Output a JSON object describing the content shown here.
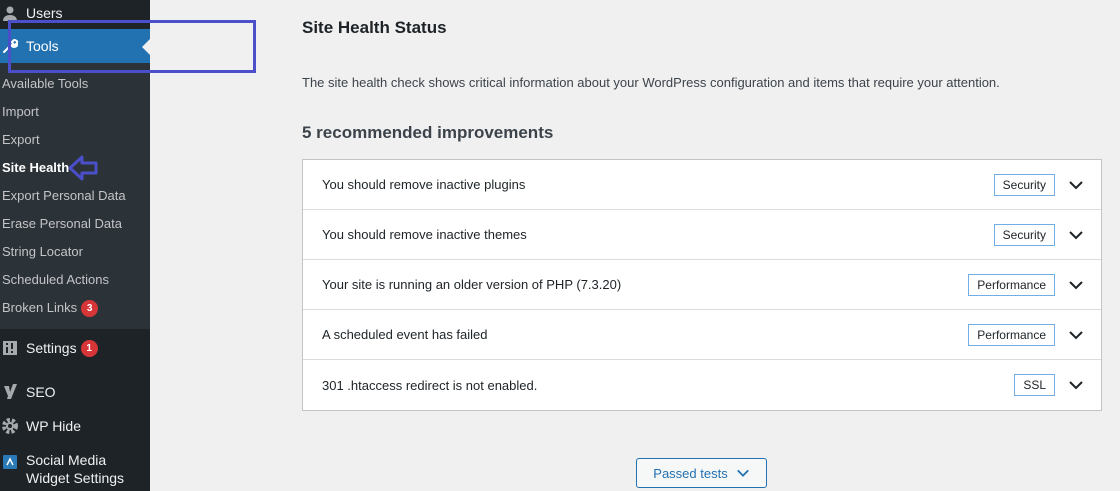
{
  "sidebar": {
    "users": "Users",
    "tools": "Tools",
    "submenu": [
      {
        "label": "Available Tools"
      },
      {
        "label": "Import"
      },
      {
        "label": "Export"
      },
      {
        "label": "Site Health"
      },
      {
        "label": "Export Personal Data"
      },
      {
        "label": "Erase Personal Data"
      },
      {
        "label": "String Locator"
      },
      {
        "label": "Scheduled Actions"
      },
      {
        "label": "Broken Links",
        "badge": "3"
      }
    ],
    "settings": {
      "label": "Settings",
      "badge": "1"
    },
    "seo": "SEO",
    "wphide": "WP Hide",
    "social": {
      "line1": "Social Media",
      "line2": "Widget Settings"
    }
  },
  "main": {
    "title": "Site Health Status",
    "description": "The site health check shows critical information about your WordPress configuration and items that require your attention.",
    "recommended_heading": "5 recommended improvements",
    "issues": [
      {
        "title": "You should remove inactive plugins",
        "badge": "Security"
      },
      {
        "title": "You should remove inactive themes",
        "badge": "Security"
      },
      {
        "title": "Your site is running an older version of PHP (7.3.20)",
        "badge": "Performance"
      },
      {
        "title": "A scheduled event has failed",
        "badge": "Performance"
      },
      {
        "title": "301 .htaccess redirect is not enabled.",
        "badge": "SSL"
      }
    ],
    "passed_button": "Passed tests"
  },
  "colors": {
    "sidebar_bg": "#1d2327",
    "submenu_bg": "#2c3338",
    "accent": "#2271b1",
    "badge_red": "#d63638",
    "annotation": "#4b4fc9"
  },
  "icons": {
    "users": "user-icon",
    "tools": "wrench-icon",
    "settings": "sliders-icon",
    "seo": "yoast-icon",
    "wphide": "gear-icon",
    "social": "social-widget-icon",
    "issue_toggle": "chevron-down-icon"
  }
}
